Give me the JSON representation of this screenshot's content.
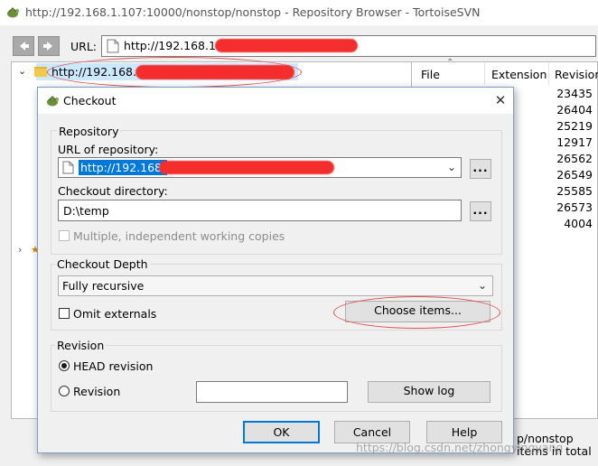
{
  "window": {
    "title": "http://192.168.1.107:10000/nonstop/nonstop - Repository Browser - TortoiseSVN"
  },
  "toolbar": {
    "back_icon": "arrow-left-icon",
    "forward_icon": "arrow-right-icon",
    "url_label": "URL:",
    "url_value": "http://192.168.1."
  },
  "tree": {
    "selected_item": "http://192.168.1.1"
  },
  "file_list": {
    "columns": [
      "File",
      "Extension",
      "Revision"
    ],
    "revisions": [
      "23435",
      "26404",
      "25219",
      "12917",
      "26562",
      "26549",
      "25585",
      "26573",
      "4004"
    ]
  },
  "status": {
    "path": "p/nonstop",
    "count": "items in total"
  },
  "watermark": "https://blog.csdn.net/zhongyingyang",
  "dialog": {
    "title": "Checkout",
    "close_glyph": "✕",
    "repository": {
      "group_label": "Repository",
      "url_label": "URL of repository:",
      "url_value": "http://192.168.",
      "browse_label": "...",
      "dir_label": "Checkout directory:",
      "dir_value": "D:\\temp",
      "dir_browse_label": "...",
      "multiple_label": "Multiple, independent working copies",
      "multiple_checked": false,
      "multiple_enabled": false
    },
    "depth": {
      "group_label": "Checkout Depth",
      "selected": "Fully recursive",
      "omit_label": "Omit externals",
      "omit_checked": false,
      "choose_label": "Choose items..."
    },
    "revision": {
      "group_label": "Revision",
      "head_label": "HEAD revision",
      "revision_label": "Revision",
      "selected": "HEAD revision",
      "revision_value": "",
      "show_log_label": "Show log"
    },
    "buttons": {
      "ok": "OK",
      "cancel": "Cancel",
      "help": "Help"
    }
  },
  "colors": {
    "selection": "#cce8ff",
    "accent": "#0078d7",
    "annotation": "#e05050",
    "redaction": "#f42d2d"
  }
}
